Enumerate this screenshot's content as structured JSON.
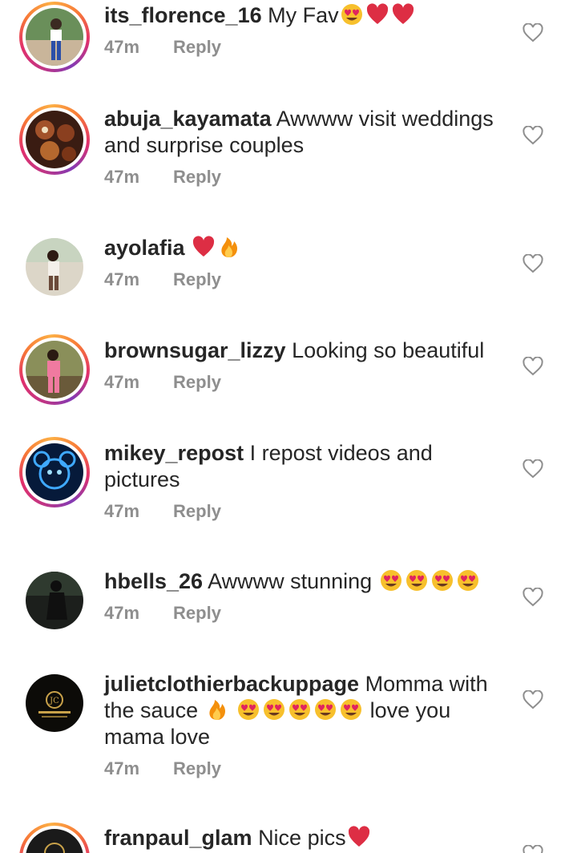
{
  "comments": [
    {
      "username": "its_florence_16",
      "text": "My Fav",
      "emojis_after": [
        "heart-eyes-icon",
        "red-heart-icon",
        "red-heart-icon"
      ],
      "time": "47m",
      "reply": "Reply",
      "story_ring": true
    },
    {
      "username": "abuja_kayamata",
      "text": "Awwww visit weddings and surprise couples",
      "time": "47m",
      "reply": "Reply",
      "story_ring": true
    },
    {
      "username": "ayolafia",
      "text": "",
      "emojis_after": [
        "red-heart-icon",
        "fire-icon"
      ],
      "time": "47m",
      "reply": "Reply",
      "story_ring": false
    },
    {
      "username": "brownsugar_lizzy",
      "text": "Looking so beautiful",
      "time": "47m",
      "reply": "Reply",
      "story_ring": true
    },
    {
      "username": "mikey_repost",
      "text": "I repost videos and pictures",
      "time": "47m",
      "reply": "Reply",
      "story_ring": true
    },
    {
      "username": "hbells_26",
      "text": "Awwww stunning",
      "emojis_after": [
        "heart-eyes-icon",
        "heart-eyes-icon",
        "heart-eyes-icon",
        "heart-eyes-icon"
      ],
      "time": "47m",
      "reply": "Reply",
      "story_ring": false
    },
    {
      "username": "julietclothierbackuppage",
      "text_a": "Momma with the sauce",
      "text_b": "love you mama love",
      "time": "47m",
      "reply": "Reply",
      "story_ring": false
    },
    {
      "username": "franpaul_glam",
      "text": "Nice pics",
      "emojis_after": [
        "red-heart-icon"
      ],
      "time": "",
      "reply": "",
      "story_ring": true
    }
  ],
  "colors": {
    "text": "#262626",
    "meta": "#8e8e8e",
    "heart_outline": "#8e8e8e"
  }
}
